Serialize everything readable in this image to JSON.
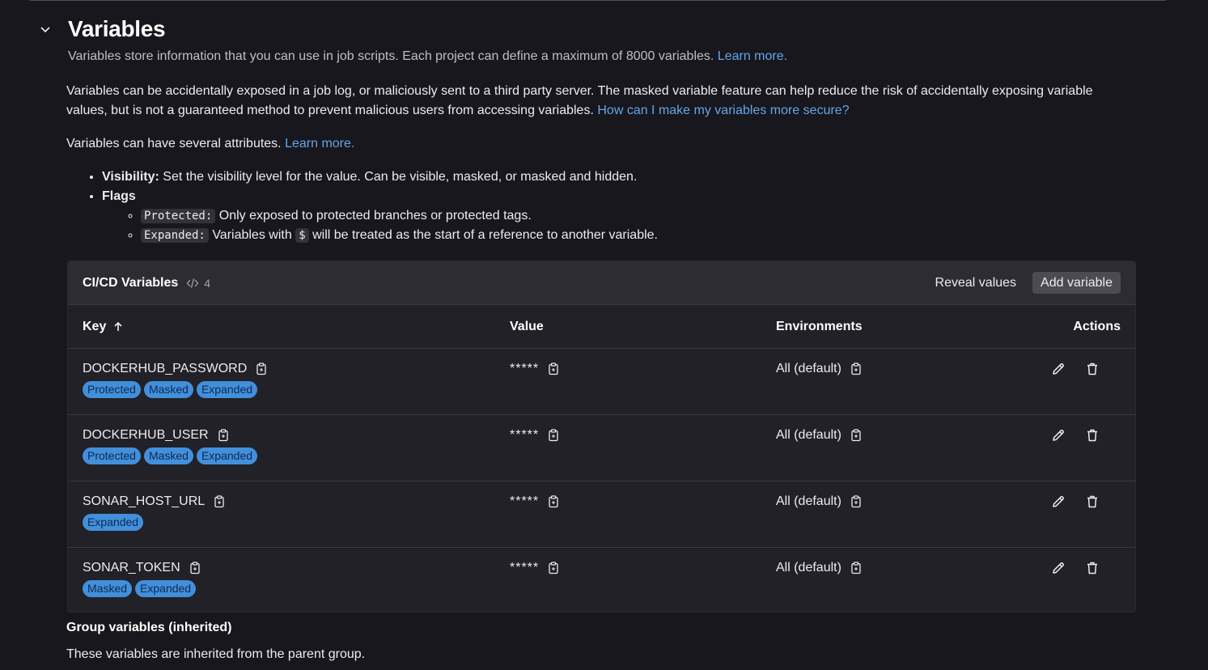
{
  "section": {
    "title": "Variables",
    "description": "Variables store information that you can use in job scripts. Each project can define a maximum of 8000 variables.",
    "description_link": "Learn more.",
    "warning_text": "Variables can be accidentally exposed in a job log, or maliciously sent to a third party server. The masked variable feature can help reduce the risk of accidentally exposing variable values, but is not a guaranteed method to prevent malicious users from accessing variables.",
    "warning_link": "How can I make my variables more secure?",
    "attributes_text": "Variables can have several attributes.",
    "attributes_link": "Learn more.",
    "visibility_label": "Visibility:",
    "visibility_text": "Set the visibility level for the value. Can be visible, masked, or masked and hidden.",
    "flags_label": "Flags",
    "protected_code": "Protected:",
    "protected_text": "Only exposed to protected branches or protected tags.",
    "expanded_code": "Expanded:",
    "expanded_text_before": "Variables with",
    "dollar_code": "$",
    "expanded_text_after": "will be treated as the start of a reference to another variable."
  },
  "card": {
    "title": "CI/CD Variables",
    "count": "4",
    "reveal_label": "Reveal values",
    "add_label": "Add variable"
  },
  "table": {
    "headers": {
      "key": "Key",
      "value": "Value",
      "environments": "Environments",
      "actions": "Actions"
    },
    "rows": [
      {
        "key": "DOCKERHUB_PASSWORD",
        "badges": [
          "Protected",
          "Masked",
          "Expanded"
        ],
        "value": "*****",
        "env": "All (default)"
      },
      {
        "key": "DOCKERHUB_USER",
        "badges": [
          "Protected",
          "Masked",
          "Expanded"
        ],
        "value": "*****",
        "env": "All (default)"
      },
      {
        "key": "SONAR_HOST_URL",
        "badges": [
          "Expanded"
        ],
        "value": "*****",
        "env": "All (default)"
      },
      {
        "key": "SONAR_TOKEN",
        "badges": [
          "Masked",
          "Expanded"
        ],
        "value": "*****",
        "env": "All (default)"
      }
    ]
  },
  "group": {
    "title": "Group variables (inherited)",
    "description": "These variables are inherited from the parent group."
  },
  "colors": {
    "background": "#18171d",
    "card": "#222127",
    "link": "#63a6e9",
    "badge": "#428fdc"
  }
}
